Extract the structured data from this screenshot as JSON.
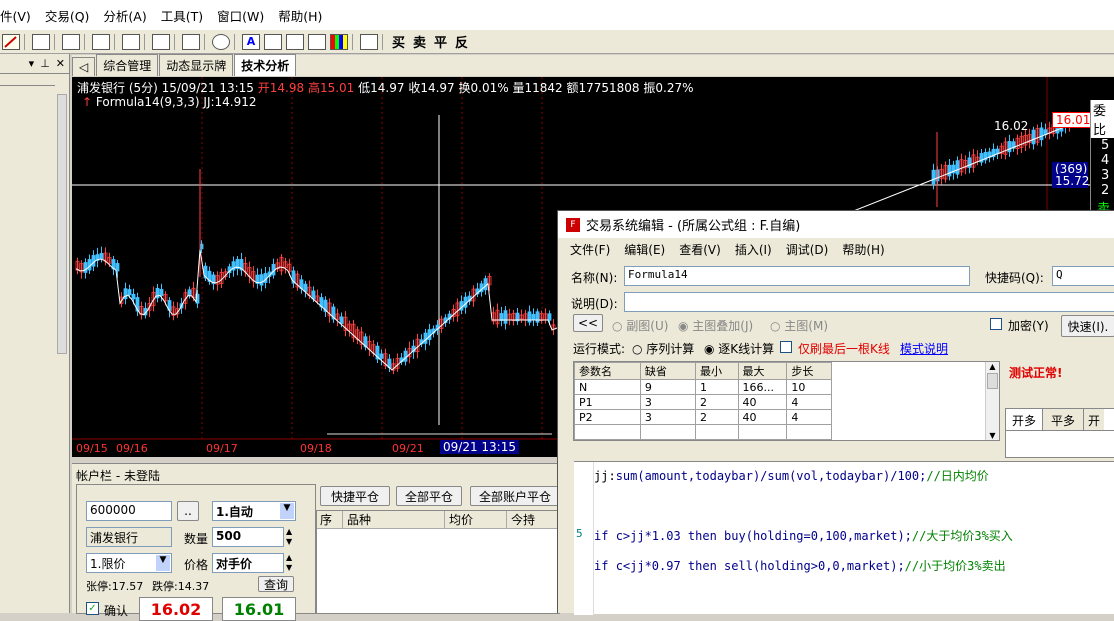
{
  "menu": {
    "items": [
      "件(V)",
      "交易(Q)",
      "分析(A)",
      "工具(T)",
      "窗口(W)",
      "帮助(H)"
    ]
  },
  "toolbar": {
    "trade_buttons": [
      "买",
      "卖",
      "平",
      "反"
    ]
  },
  "tabs": {
    "arrow": "◁",
    "items": [
      "综合管理",
      "动态显示牌",
      "技术分析"
    ]
  },
  "chart": {
    "info_name": "浦发银行 (5分) 15/09/21 13:15",
    "open": "开14.98",
    "high": "高15.01",
    "low": "低14.97",
    "close": "收14.97",
    "turnover": "换0.01%",
    "volume": "量11842",
    "amount": "额17751808",
    "amp": "振0.27%",
    "formula_label": "Formula14(9,3,3)",
    "jj_value": "JJ:14.912",
    "price_tag": "16.01",
    "price_top": "16.02",
    "count_tag": "(369)",
    "level_tag": "15.72",
    "right_panel_title": "委比",
    "right_panel_nums": [
      "5",
      "4",
      "3",
      "2"
    ],
    "right_panel_sell": "卖",
    "date_labels": [
      "09/15",
      "09/16",
      "09/17",
      "09/18",
      "09/21"
    ],
    "cursor_label": "09/21 13:15",
    "chart_colors": {
      "up": "#ff4040",
      "down": "#40c0ff",
      "avg": "#ffffff",
      "cross": "#ffffff",
      "grid": "#8b0000"
    }
  },
  "account": {
    "title": "帐户栏 - 未登陆",
    "code": "600000",
    "dots": "..",
    "mode": "1.自动",
    "stock_name": "浦发银行",
    "qty_label": "数量",
    "qty": "500",
    "order_type": "1.限价",
    "price_label": "价格",
    "price_mode": "对手价",
    "limit_up": "张停:17.57",
    "limit_down": "跌停:14.37",
    "query_btn": "查询",
    "confirm_label": "确认",
    "buy_price": "16.02",
    "sell_price": "16.01",
    "quick_close": "快捷平仓",
    "close_all": "全部平仓",
    "close_all_acct": "全部账户平仓",
    "cols": [
      "序",
      "品种",
      "均价",
      "今持"
    ]
  },
  "dialog": {
    "title": "交易系统编辑 - (所属公式组 : F.自编)",
    "menu": [
      "文件(F)",
      "编辑(E)",
      "查看(V)",
      "插入(I)",
      "调试(D)",
      "帮助(H)"
    ],
    "name_label": "名称(N):",
    "name_value": "Formula14",
    "hotkey_label": "快捷码(Q):",
    "hotkey_value": "Q",
    "desc_label": "说明(D):",
    "desc_value": "",
    "back_btn": "<<",
    "radio_sub": "副图(U)",
    "radio_overlay": "主图叠加(J)",
    "radio_main": "主图(M)",
    "encrypt_label": "加密(Y)",
    "quick_btn": "快速(I).",
    "run_mode_label": "运行模式:",
    "seq_calc": "序列计算",
    "bar_calc": "逐K线计算",
    "last_only": "仅刷最后一根K线",
    "mode_help": "模式说明",
    "param_headers": [
      "参数名",
      "缺省",
      "最小",
      "最大",
      "步长"
    ],
    "params": [
      [
        "N",
        "9",
        "1",
        "166...",
        "10"
      ],
      [
        "P1",
        "3",
        "2",
        "40",
        "4"
      ],
      [
        "P2",
        "3",
        "2",
        "40",
        "4"
      ]
    ],
    "test_ok": "测试正常!",
    "side_tabs": [
      "开多",
      "平多",
      "开"
    ],
    "line_number": "5",
    "code_lines": [
      {
        "a": "jj:",
        "b": "sum(amount,todaybar)/sum(vol,todaybar)/100;",
        "c": "//日内均价"
      },
      {
        "a": "if ",
        "b": "c>jj*1.03 then buy(holding=0,100,market);",
        "c": "//大于均价3%买入"
      },
      {
        "a": "if ",
        "b": "c<jj*0.97 then sell(holding>0,0,market);",
        "c": "//小于均价3%卖出"
      }
    ]
  }
}
